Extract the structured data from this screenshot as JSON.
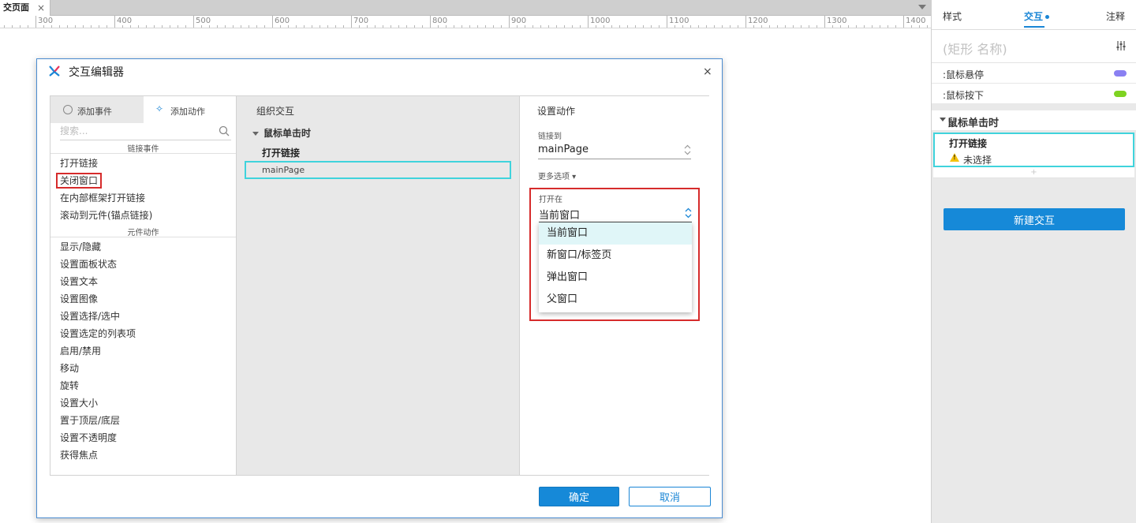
{
  "doc_tab": {
    "label": "交页面",
    "close": "×"
  },
  "ruler": {
    "labels": [
      "300",
      "400",
      "500",
      "600",
      "700",
      "800",
      "900",
      "1000",
      "1100",
      "1200",
      "1300",
      "1400"
    ]
  },
  "right_panel": {
    "tabs": {
      "style": "样式",
      "interactions": "交互",
      "notes": "注释"
    },
    "shape_name_placeholder": "(矩形 名称)",
    "events": [
      {
        "label": ":鼠标悬停",
        "color": "#8a80f2"
      },
      {
        "label": ":鼠标按下",
        "color": "#7ed321"
      }
    ],
    "case": {
      "title": "鼠标单击时",
      "action": "打开链接",
      "warning": "未选择"
    },
    "add_symbol": "+",
    "new_interaction": "新建交互"
  },
  "dialog": {
    "title": "交互编辑器",
    "close": "×",
    "left": {
      "tab_add_event": "添加事件",
      "tab_add_action": "添加动作",
      "search_placeholder": "搜索...",
      "section_link": "链接事件",
      "link_items": [
        "打开链接",
        "关闭窗口",
        "在内部框架打开链接",
        "滚动到元件(锚点链接)"
      ],
      "section_widget": "元件动作",
      "widget_items": [
        "显示/隐藏",
        "设置面板状态",
        "设置文本",
        "设置图像",
        "设置选择/选中",
        "设置选定的列表项",
        "启用/禁用",
        "移动",
        "旋转",
        "设置大小",
        "置于顶层/底层",
        "设置不透明度",
        "获得焦点"
      ]
    },
    "middle": {
      "title": "组织交互",
      "case": "鼠标单击时",
      "action": "打开链接",
      "target": "mainPage"
    },
    "right": {
      "title": "设置动作",
      "link_label": "链接到",
      "link_value": "mainPage",
      "more_options": "更多选项 ▾",
      "open_in_label": "打开在",
      "open_in_value": "当前窗口",
      "open_in_options": [
        "当前窗口",
        "新窗口/标签页",
        "弹出窗口",
        "父窗口"
      ]
    },
    "ok": "确定",
    "cancel": "取消"
  },
  "colors": {
    "accent": "#1689d8",
    "highlight_border": "#d62b2b",
    "selection_border": "#3fd3dc"
  }
}
